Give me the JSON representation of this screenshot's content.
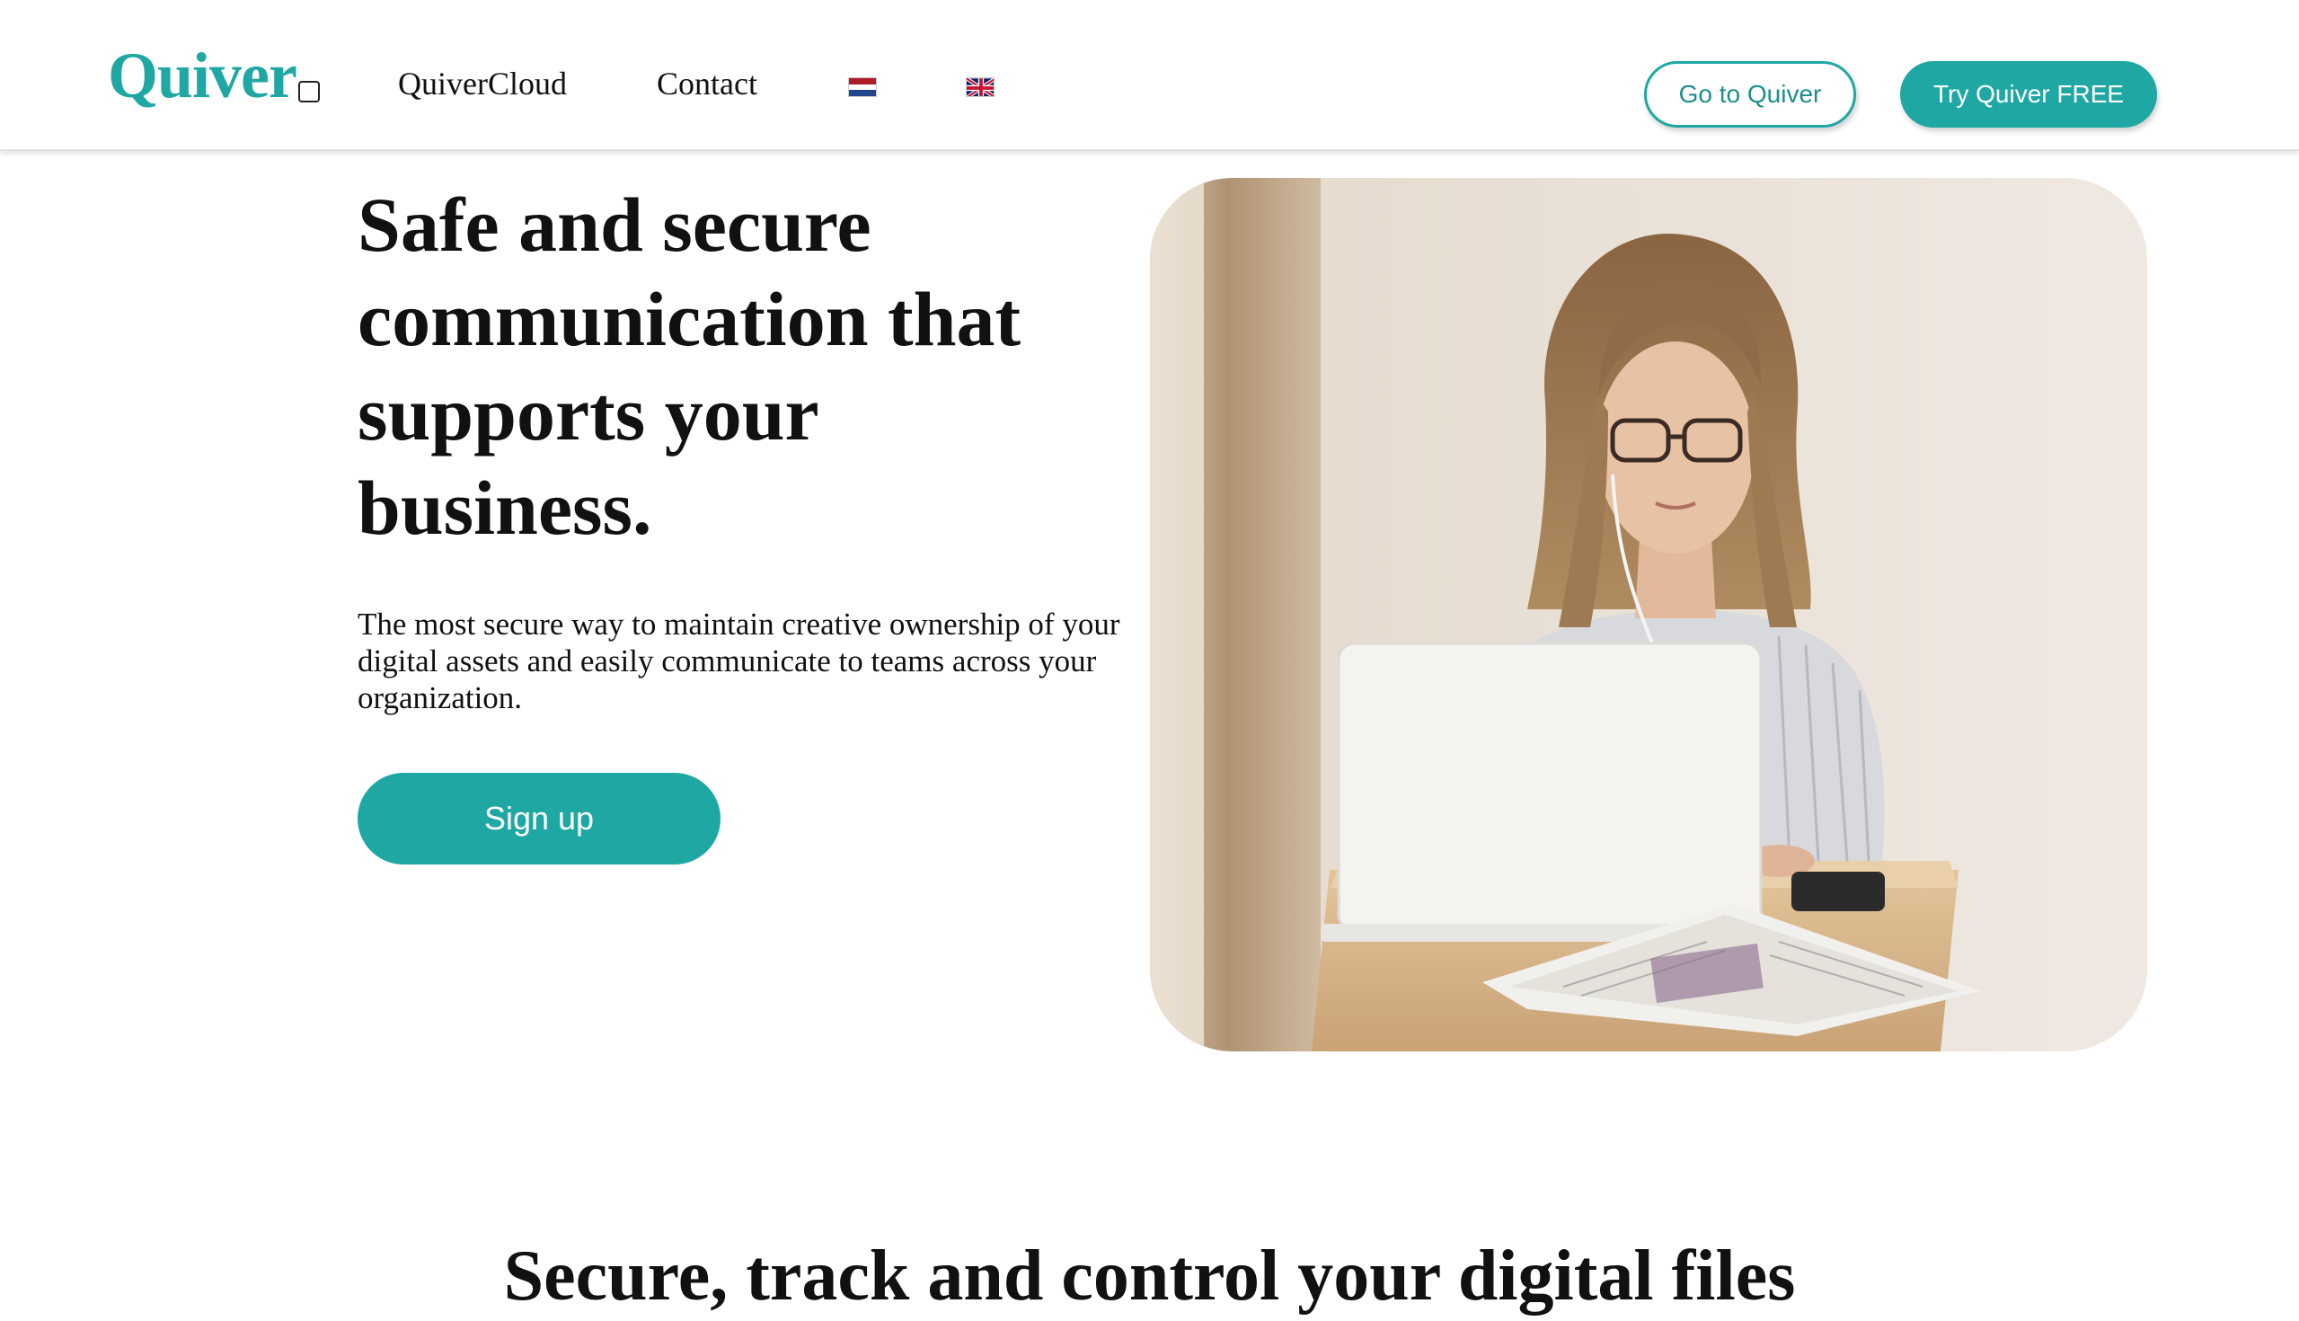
{
  "header": {
    "logo_text": "Quiver",
    "nav": {
      "quivercloud_label": "QuiverCloud",
      "contact_label": "Contact"
    },
    "language_flags": [
      "dutch-flag-icon",
      "uk-flag-icon"
    ],
    "go_to_quiver_label": "Go to Quiver",
    "try_free_label": "Try Quiver FREE"
  },
  "hero": {
    "title": "Safe and secure communication that supports your business.",
    "description": "The most secure way to maintain creative ownership of your digital assets and easily communicate to teams across your organization.",
    "signup_label": "Sign up",
    "image": "woman-working-on-laptop-photo"
  },
  "section": {
    "title": "Secure, track and control your digital files"
  },
  "colors": {
    "brand_teal": "#1fa8a3",
    "text": "#111111",
    "background": "#ffffff"
  }
}
